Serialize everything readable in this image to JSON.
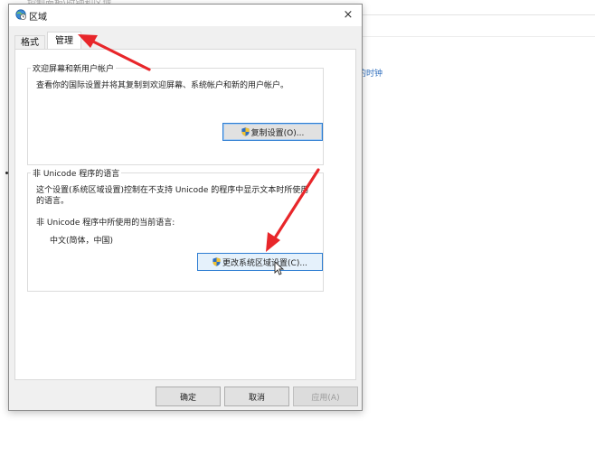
{
  "background": {
    "window_title_partial": "控制面板\\时钟和区域",
    "link_partial": "的时钟"
  },
  "dialog": {
    "title": "区域",
    "close_glyph": "×",
    "tabs": [
      {
        "label": "格式",
        "selected": false
      },
      {
        "label": "管理",
        "selected": true
      }
    ],
    "welcome_group": {
      "legend": "欢迎屏幕和新用户帐户",
      "description": "查看你的国际设置并将其复制到欢迎屏幕、系统帐户和新的用户帐户。",
      "copy_button_label": "复制设置(O)..."
    },
    "unicode_group": {
      "legend": "非 Unicode 程序的语言",
      "description_line1": "这个设置(系统区域设置)控制在不支持 Unicode 的程序中显示文本时所使用",
      "description_line2": "的语言。",
      "current_label": "非 Unicode 程序中所使用的当前语言:",
      "current_value": "中文(简体，中国)",
      "change_button_label": "更改系统区域设置(C)..."
    },
    "buttons": {
      "ok": "确定",
      "cancel": "取消",
      "apply": "应用(A)"
    }
  },
  "colors": {
    "accent_blue": "#2d7dd2",
    "annotation_red": "#e8262a",
    "shield_blue": "#2f6ebd",
    "shield_yellow": "#f2c230"
  },
  "icons": [
    "globe-clock-icon",
    "close-icon",
    "uac-shield-icon",
    "mouse-cursor-icon"
  ]
}
